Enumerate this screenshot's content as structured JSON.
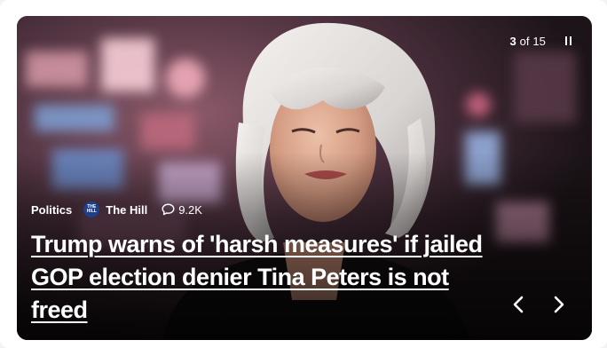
{
  "slideshow": {
    "counter": {
      "current": "3",
      "separator": "of",
      "total": "15"
    }
  },
  "article": {
    "category": "Politics",
    "source": {
      "name": "The Hill",
      "logo_text": "THE HILL"
    },
    "comments_count": "9.2K",
    "headline": "Trump warns of 'harsh measures' if jailed GOP election denier Tina Peters is not freed"
  },
  "icons": {
    "pause": "pause-icon",
    "comment": "comment-icon",
    "prev": "chevron-left-icon",
    "next": "chevron-right-icon"
  },
  "colors": {
    "text": "#ffffff",
    "source_logo_bg": "#1e3f8a"
  }
}
